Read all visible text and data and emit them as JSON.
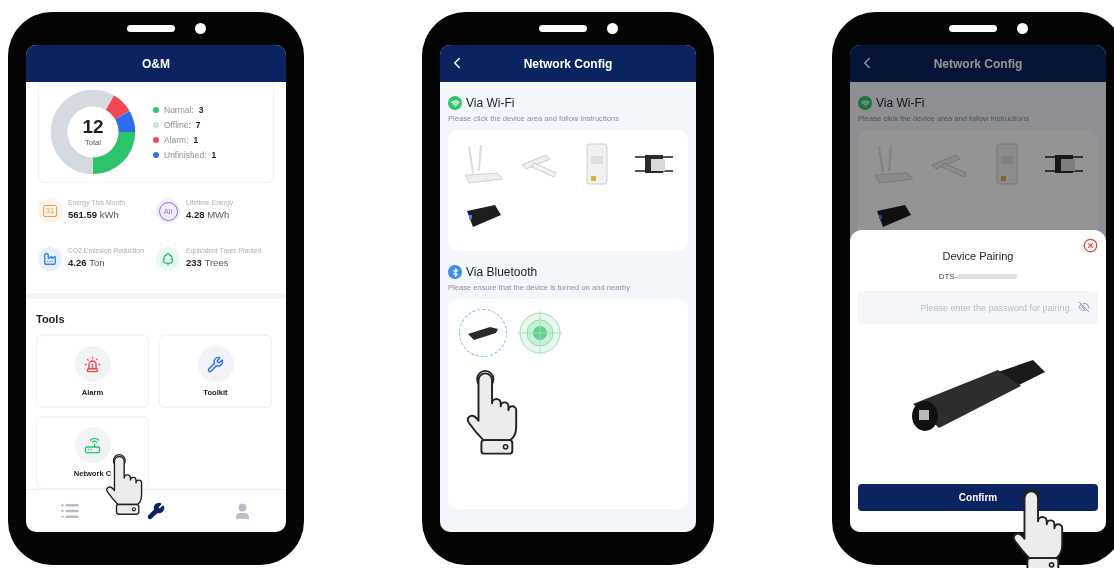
{
  "phones": [
    {
      "kind": "om",
      "title": "O&M",
      "summary": {
        "total": "12",
        "total_label": "Total",
        "legend": [
          {
            "label": "Normal:",
            "value": "3",
            "color": "#2ec46b"
          },
          {
            "label": "Offline:",
            "value": "7",
            "color": "#d5d9e0"
          },
          {
            "label": "Alarm:",
            "value": "1",
            "color": "#f2484f"
          },
          {
            "label": "Unfinished:",
            "value": "1",
            "color": "#2f6cf0"
          }
        ]
      },
      "stats": [
        {
          "kind": "calendar",
          "badge": "31",
          "color": "#f59a45",
          "label": "Energy This Month",
          "value": "561.59",
          "unit": "kWh"
        },
        {
          "kind": "all",
          "badge": "All",
          "color": "#8b6cf0",
          "label": "Lifetime Energy",
          "value": "4.28",
          "unit": "MWh"
        },
        {
          "kind": "factory",
          "color": "#3b82f6",
          "label": "CO2 Emission Reduction",
          "value": "4.26",
          "unit": "Ton"
        },
        {
          "kind": "tree",
          "color": "#34c27a",
          "label": "Equivalent Trees Planted",
          "value": "233",
          "unit": "Trees"
        }
      ],
      "tools_title": "Tools",
      "tools": [
        {
          "kind": "alarm",
          "label": "Alarm"
        },
        {
          "kind": "toolkit",
          "label": "Toolkit"
        },
        {
          "kind": "network",
          "label": "Network C"
        }
      ],
      "nav": [
        {
          "kind": "list",
          "selected": false
        },
        {
          "kind": "tools",
          "selected": true
        },
        {
          "kind": "profile",
          "selected": false
        }
      ]
    },
    {
      "kind": "network",
      "title": "Network Config",
      "sections": [
        {
          "kind": "wifi",
          "title": "Via Wi-Fi",
          "hint": "Please click the device area and follow instructions",
          "devices": [
            {
              "kind": "router",
              "selected": false
            },
            {
              "kind": "dongle",
              "selected": false
            },
            {
              "kind": "meter",
              "selected": false
            },
            {
              "kind": "microinverter",
              "selected": false
            },
            {
              "kind": "stick",
              "selected": false
            }
          ]
        },
        {
          "kind": "bluetooth",
          "title": "Via Bluetooth",
          "hint": "Please ensure that the device is turned on and nearby",
          "devices": [
            {
              "kind": "bt-stick",
              "selected": true
            },
            {
              "kind": "scanner",
              "selected": false
            }
          ]
        }
      ]
    },
    {
      "kind": "pairing",
      "title": "Network Config",
      "sections": [
        {
          "kind": "wifi",
          "title": "Via Wi-Fi",
          "hint": "Please click the device area and follow instructions",
          "devices": [
            {
              "kind": "router",
              "selected": false
            },
            {
              "kind": "dongle",
              "selected": false
            },
            {
              "kind": "meter",
              "selected": false
            },
            {
              "kind": "microinverter",
              "selected": false
            },
            {
              "kind": "stick",
              "selected": false
            }
          ]
        }
      ],
      "dialog": {
        "title": "Device Pairing",
        "device_id": "DTS-",
        "placeholder": "Please enter the password for pairing.",
        "button": "Confirm"
      }
    }
  ]
}
